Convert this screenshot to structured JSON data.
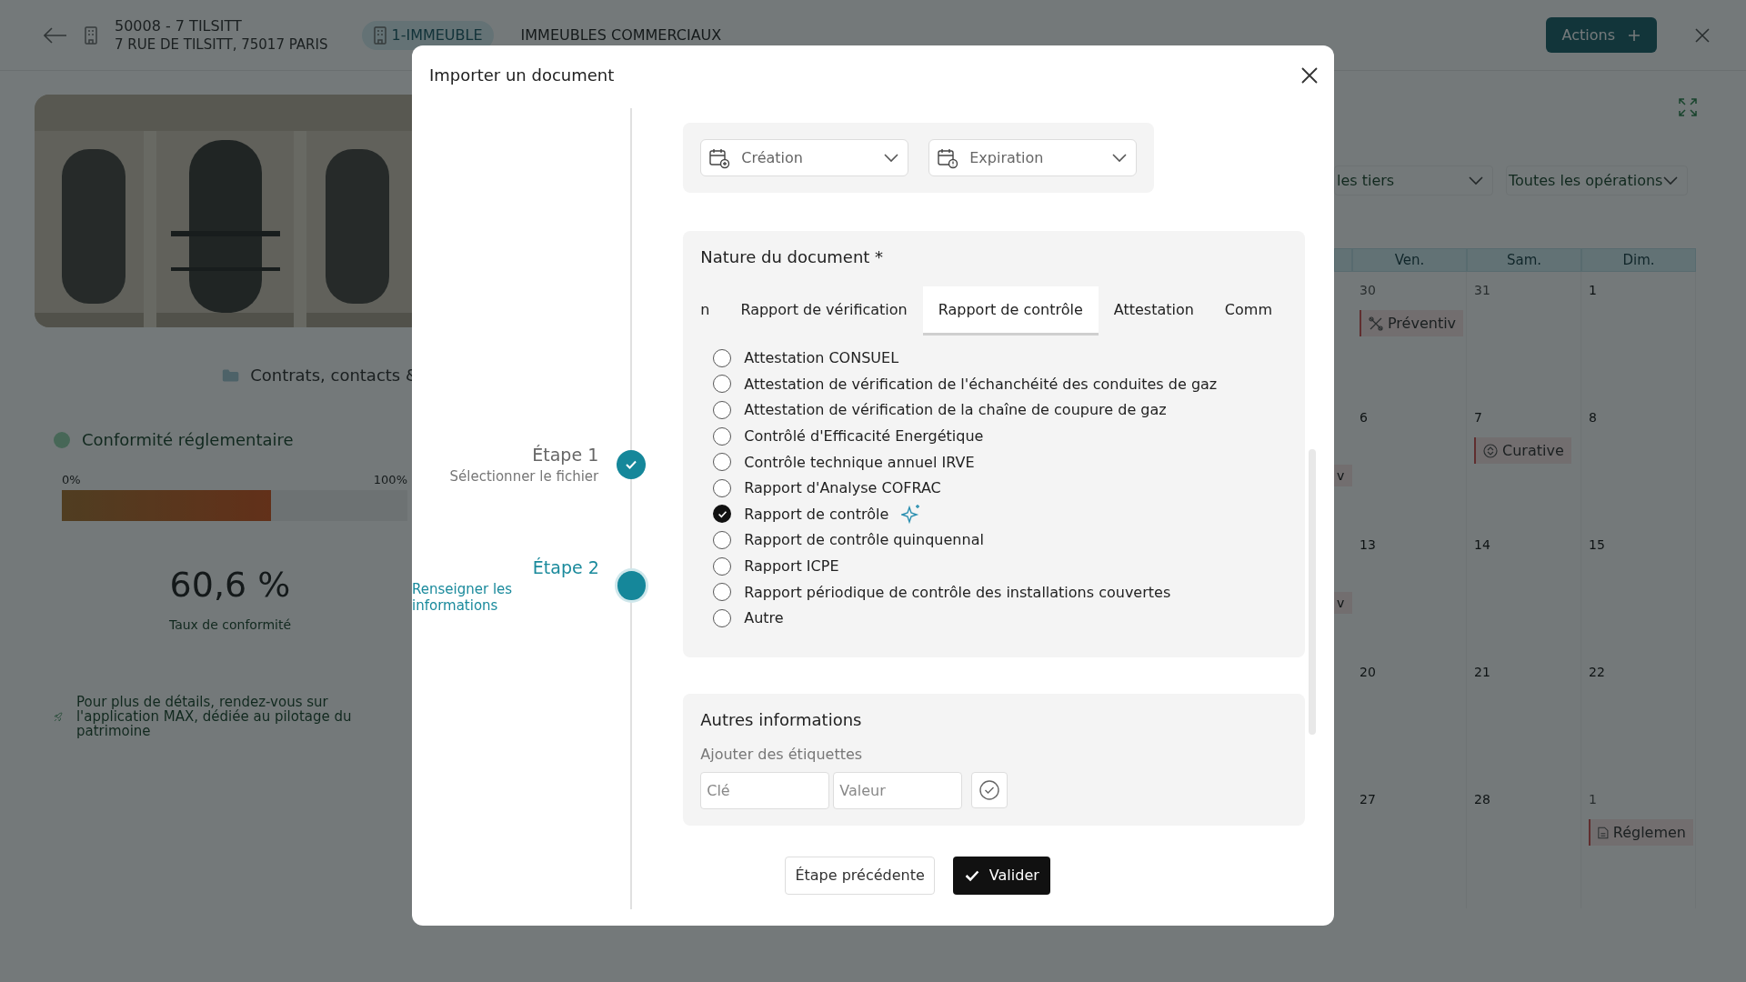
{
  "header": {
    "title": "50008 - 7 TILSITT",
    "address": "7 RUE DE TILSITT, 75017 PARIS",
    "tabs": [
      {
        "label": "1-IMMEUBLE",
        "selected": true
      },
      {
        "label": "IMMEUBLES COMMERCIAUX",
        "selected": false
      }
    ],
    "actions_button": "Actions"
  },
  "left_panel": {
    "section_link": "Contrats, contacts &",
    "compliance": {
      "title": "Conformité réglementaire",
      "scale_min": "0%",
      "scale_max": "100%",
      "level": 0.606,
      "value": "60,6 %",
      "caption": "Taux de conformité"
    },
    "note": "Pour plus de détails, rendez-vous sur l'application MAX, dédiée au pilotage du patrimoine"
  },
  "calendar": {
    "filters": [
      "les tiers",
      "Toutes les opérations"
    ],
    "columns": [
      "Ven.",
      "Sam.",
      "Dim."
    ],
    "weeks": [
      {
        "days": [
          {
            "number": "30",
            "muted": true,
            "event": {
              "label": "Préventiv",
              "kind": "preventive"
            }
          },
          {
            "number": "31",
            "muted": true
          },
          {
            "number": "1",
            "muted": false
          }
        ]
      },
      {
        "edge_event": "v",
        "days": [
          {
            "number": "6",
            "muted": false
          },
          {
            "number": "7",
            "muted": false,
            "event": {
              "label": "Curative",
              "kind": "curative"
            }
          },
          {
            "number": "8",
            "muted": false
          }
        ]
      },
      {
        "edge_event": "v",
        "days": [
          {
            "number": "13",
            "muted": false
          },
          {
            "number": "14",
            "muted": false
          },
          {
            "number": "15",
            "muted": false
          }
        ]
      },
      {
        "days": [
          {
            "number": "20",
            "muted": false
          },
          {
            "number": "21",
            "muted": false
          },
          {
            "number": "22",
            "muted": false
          }
        ]
      },
      {
        "days": [
          {
            "number": "27",
            "muted": false
          },
          {
            "number": "28",
            "muted": false
          },
          {
            "number": "1",
            "muted": true,
            "event": {
              "label": "Réglemen",
              "kind": "regulatory"
            }
          }
        ]
      }
    ]
  },
  "modal": {
    "title": "Importer un document",
    "steps": [
      {
        "title": "Étape 1",
        "subtitle": "Sélectionner le fichier",
        "completed": true,
        "active": false
      },
      {
        "title": "Étape 2",
        "subtitle": "Renseigner les informations",
        "completed": false,
        "active": true
      }
    ],
    "dates": [
      {
        "label": "Création",
        "kind": "creation"
      },
      {
        "label": "Expiration",
        "kind": "expiration"
      }
    ],
    "nature": {
      "title": "Nature du document *",
      "tabs": [
        {
          "label": "n",
          "selected": false
        },
        {
          "label": "Rapport de vérification",
          "selected": false
        },
        {
          "label": "Rapport de contrôle",
          "selected": true
        },
        {
          "label": "Attestation",
          "selected": false
        },
        {
          "label": "Comm",
          "selected": false
        }
      ],
      "options": [
        {
          "label": "Attestation CONSUEL",
          "selected": false
        },
        {
          "label": "Attestation de vérification de l'échanchéité des conduites de gaz",
          "selected": false
        },
        {
          "label": "Attestation de vérification de la chaîne de coupure de gaz",
          "selected": false
        },
        {
          "label": "Contrôlé d'Efficacité Energétique",
          "selected": false
        },
        {
          "label": "Contrôle technique annuel IRVE",
          "selected": false
        },
        {
          "label": "Rapport d'Analyse COFRAC",
          "selected": false
        },
        {
          "label": "Rapport de contrôle",
          "selected": true,
          "suggested": true
        },
        {
          "label": "Rapport de contrôle quinquennal",
          "selected": false
        },
        {
          "label": "Rapport ICPE",
          "selected": false
        },
        {
          "label": "Rapport périodique de contrôle des installations couvertes",
          "selected": false
        },
        {
          "label": "Autre",
          "selected": false
        }
      ]
    },
    "other": {
      "title": "Autres informations",
      "subtitle": "Ajouter des étiquettes",
      "key_placeholder": "Clé",
      "value_placeholder": "Valeur"
    },
    "back_button": "Étape précédente",
    "submit_button": "Valider"
  }
}
